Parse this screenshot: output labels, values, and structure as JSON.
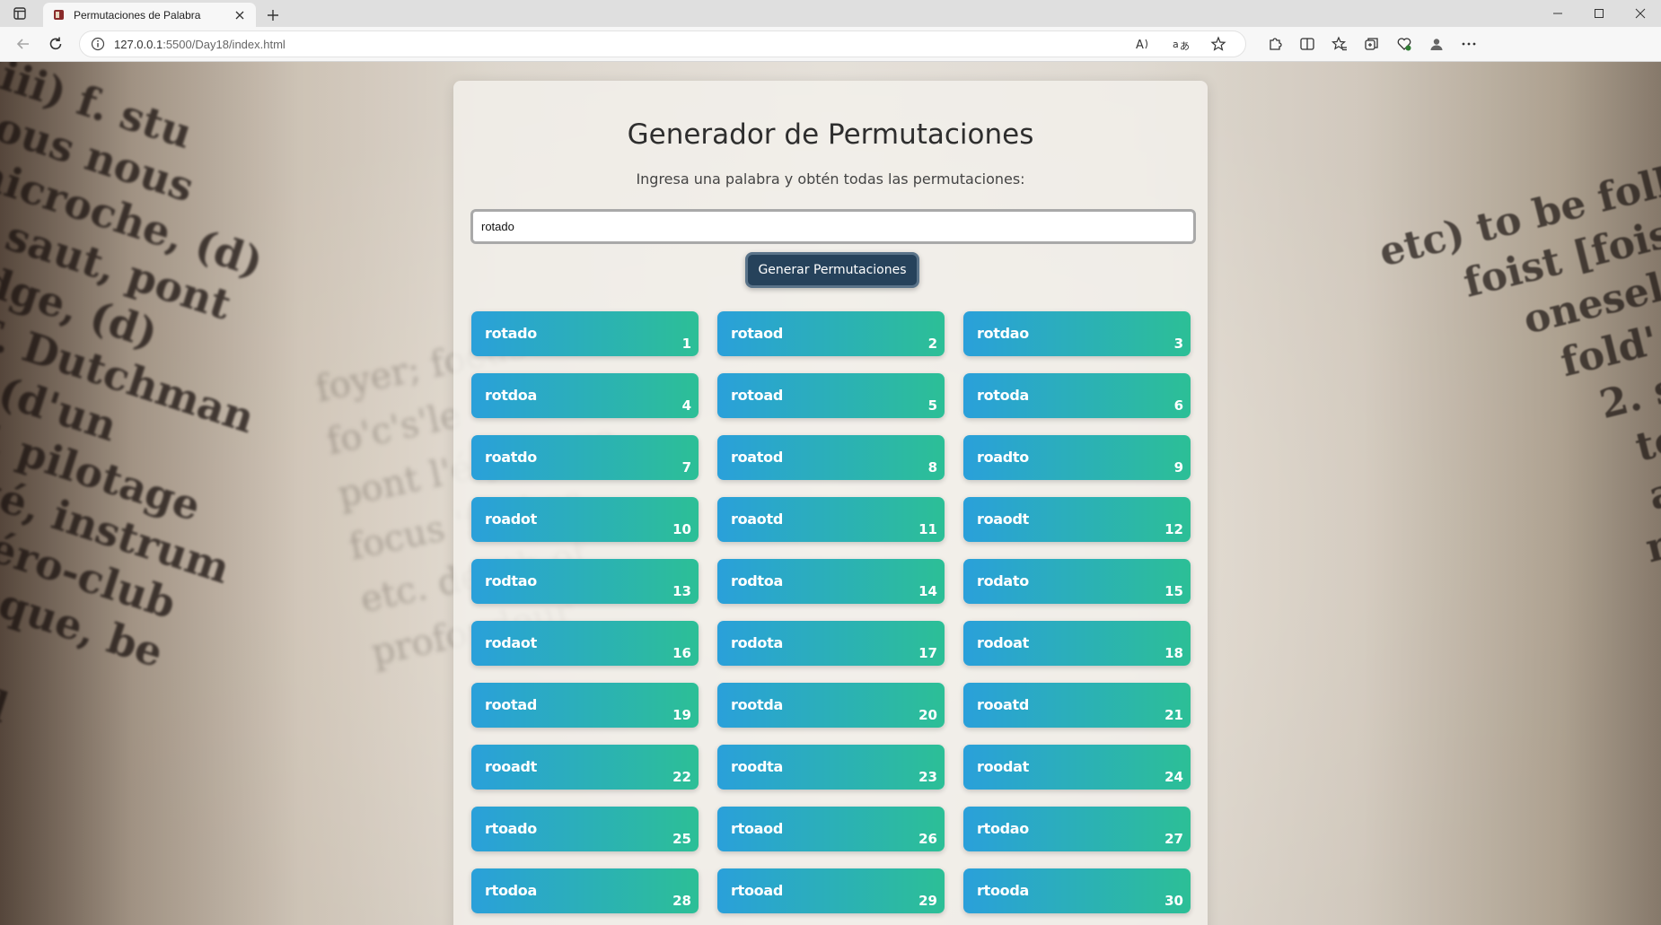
{
  "browser": {
    "tab_title": "Permutaciones de Palabra",
    "address_host": "127.0.0.1",
    "address_path": ":5500/Day18/index.html"
  },
  "page": {
    "title": "Generador de Permutaciones",
    "subtitle": "Ingresa una palabra y obtén todas las permutaciones:",
    "input_value": "rotado",
    "button_label": "Generar Permutaciones",
    "accent_colors": {
      "card_start": "#2aa0da",
      "card_end": "#2cbf96",
      "button": "#26425b"
    }
  },
  "permutations": [
    {
      "word": "rotado",
      "n": "1"
    },
    {
      "word": "rotaod",
      "n": "2"
    },
    {
      "word": "rotdao",
      "n": "3"
    },
    {
      "word": "rotdoa",
      "n": "4"
    },
    {
      "word": "rotoad",
      "n": "5"
    },
    {
      "word": "rotoda",
      "n": "6"
    },
    {
      "word": "roatdo",
      "n": "7"
    },
    {
      "word": "roatod",
      "n": "8"
    },
    {
      "word": "roadto",
      "n": "9"
    },
    {
      "word": "roadot",
      "n": "10"
    },
    {
      "word": "roaotd",
      "n": "11"
    },
    {
      "word": "roaodt",
      "n": "12"
    },
    {
      "word": "rodtao",
      "n": "13"
    },
    {
      "word": "rodtoa",
      "n": "14"
    },
    {
      "word": "rodato",
      "n": "15"
    },
    {
      "word": "rodaot",
      "n": "16"
    },
    {
      "word": "rodota",
      "n": "17"
    },
    {
      "word": "rodoat",
      "n": "18"
    },
    {
      "word": "rootad",
      "n": "19"
    },
    {
      "word": "rootda",
      "n": "20"
    },
    {
      "word": "rooatd",
      "n": "21"
    },
    {
      "word": "rooadt",
      "n": "22"
    },
    {
      "word": "roodta",
      "n": "23"
    },
    {
      "word": "roodat",
      "n": "24"
    },
    {
      "word": "rtoado",
      "n": "25"
    },
    {
      "word": "rtoaod",
      "n": "26"
    },
    {
      "word": "rtodao",
      "n": "27"
    },
    {
      "word": "rtodoa",
      "n": "28"
    },
    {
      "word": "rtooad",
      "n": "29"
    },
    {
      "word": "rtooda",
      "n": "30"
    }
  ]
}
